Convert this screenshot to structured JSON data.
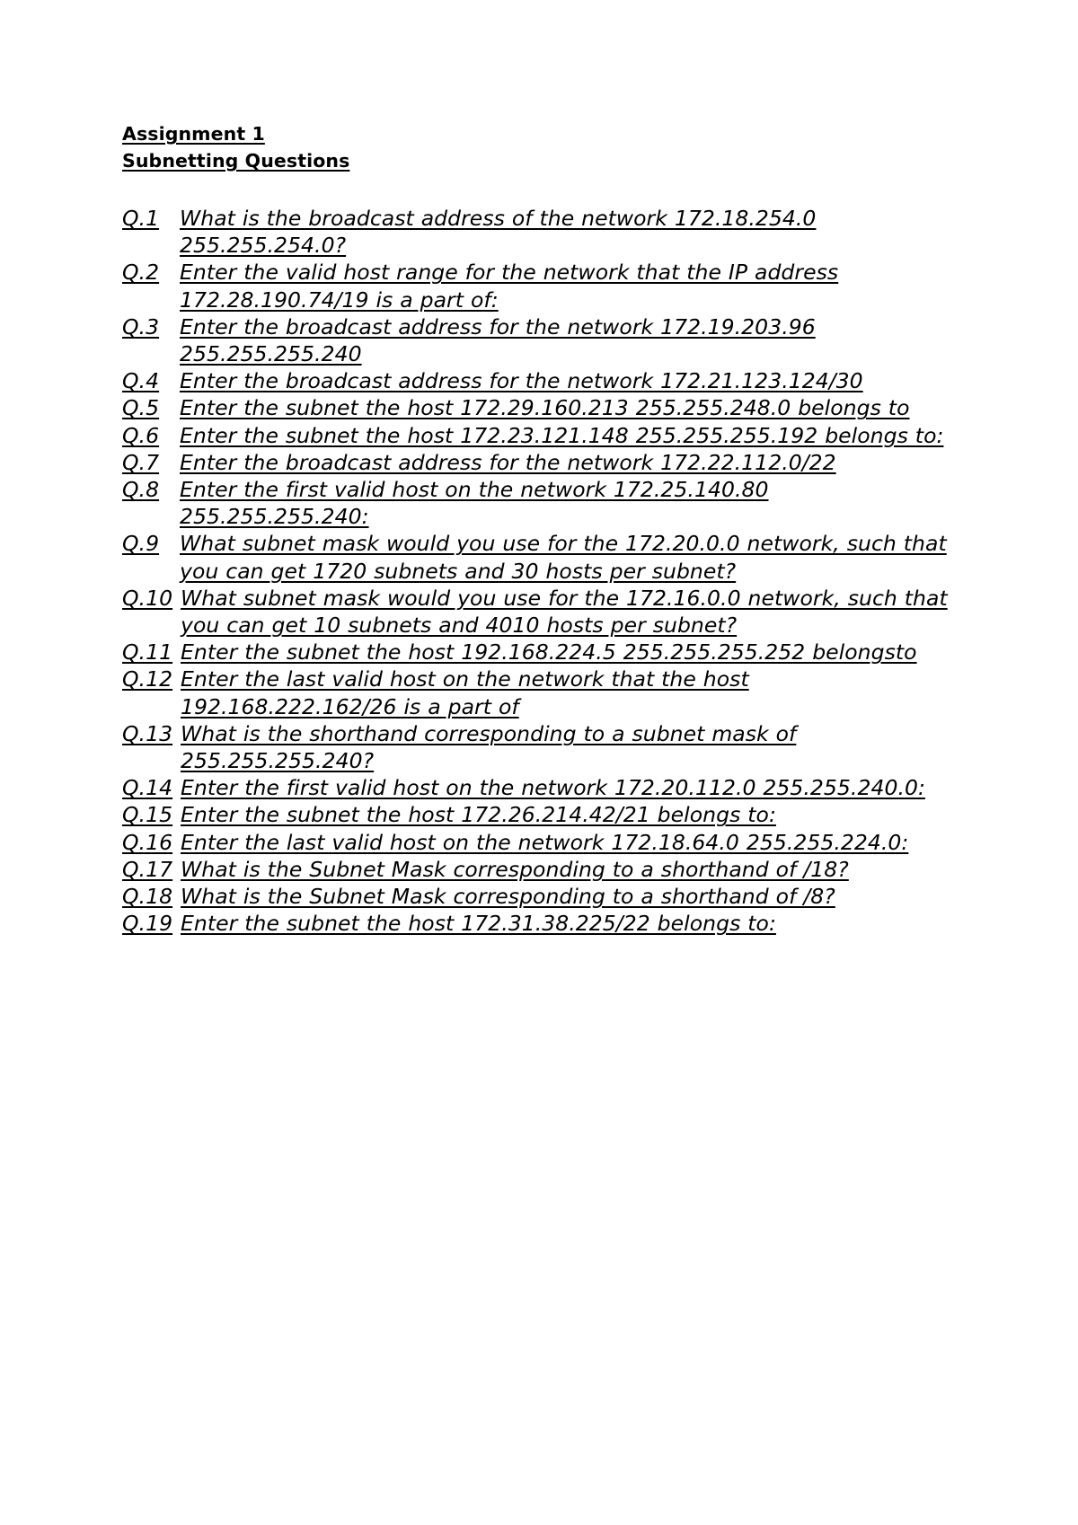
{
  "document": {
    "title_lines": [
      "Assignment 1",
      "Subnetting Questions"
    ],
    "questions": [
      {
        "number": "Q.1",
        "text": "What is the broadcast address of the network 172.18.254.0 255.255.254.0?"
      },
      {
        "number": "Q.2",
        "text": "Enter the valid host range for the network that the IP address 172.28.190.74/19 is a part of:"
      },
      {
        "number": "Q.3",
        "text": "Enter the broadcast address for the network 172.19.203.96 255.255.255.240"
      },
      {
        "number": "Q.4",
        "text": "Enter the broadcast address for the network 172.21.123.124/30"
      },
      {
        "number": "Q.5",
        "text": "Enter the subnet the host 172.29.160.213 255.255.248.0 belongs to"
      },
      {
        "number": "Q.6",
        "text": "Enter the subnet the host 172.23.121.148 255.255.255.192 belongs to:"
      },
      {
        "number": "Q.7",
        "text": "Enter the broadcast address for the network 172.22.112.0/22"
      },
      {
        "number": "Q.8",
        "text": "Enter the first valid host on the network 172.25.140.80 255.255.255.240:"
      },
      {
        "number": "Q.9",
        "text": "What subnet mask would you use for the 172.20.0.0 network, such that you can get 1720 subnets and 30 hosts per subnet?"
      },
      {
        "number": "Q.10",
        "text": "What subnet mask would you use for the 172.16.0.0 network, such that you can get 10 subnets and 4010 hosts per subnet?"
      },
      {
        "number": "Q.11",
        "text": "Enter the subnet the host 192.168.224.5 255.255.255.252 belongsto"
      },
      {
        "number": "Q.12",
        "text": "Enter the last valid host on the network that the host 192.168.222.162/26 is a part of"
      },
      {
        "number": "Q.13",
        "text": "What is the shorthand corresponding to a subnet mask of 255.255.255.240?"
      },
      {
        "number": "Q.14",
        "text": "Enter the first valid host on the network 172.20.112.0 255.255.240.0:"
      },
      {
        "number": "Q.15",
        "text": "Enter the subnet the host 172.26.214.42/21 belongs to:"
      },
      {
        "number": "Q.16",
        "text": "Enter the last valid host on the network 172.18.64.0 255.255.224.0:"
      },
      {
        "number": "Q.17",
        "text": "What is the Subnet Mask corresponding to a shorthand of /18?"
      },
      {
        "number": "Q.18",
        "text": "What is the Subnet Mask corresponding to a shorthand of /8?"
      },
      {
        "number": "Q.19",
        "text": "Enter the subnet the host 172.31.38.225/22 belongs to:"
      }
    ]
  },
  "colors": {
    "page_background": "#ffffff",
    "text": "#000000"
  }
}
